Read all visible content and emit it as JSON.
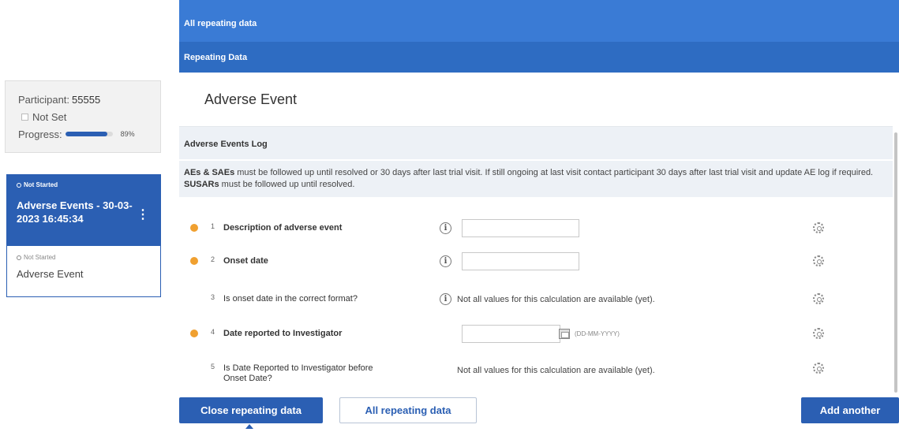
{
  "sidebar": {
    "participant_label": "Participant:",
    "participant_id": "55555",
    "status_label": "Not Set",
    "progress_label": "Progress:",
    "progress_value": 0.89,
    "progress_text": "89%",
    "event_card": {
      "status": "Not Started",
      "title": "Adverse Events - 30-03-2023 16:45:34",
      "menu_icon": "kebab-menu-icon",
      "sub_status": "Not Started",
      "sub_label": "Adverse Event"
    }
  },
  "main": {
    "all_repeating_label": "All repeating data",
    "repeating_label": "Repeating Data",
    "form_title": "Adverse Event",
    "section_title": "Adverse Events Log",
    "info": {
      "part1_bold": "AEs & SAEs",
      "part2": " must be followed up until resolved or 30 days after last trial visit. If still ongoing at last visit contact participant 30 days after last trial visit and update AE log if required. ",
      "part3_bold": "SUSARs",
      "part4": " must be followed up until resolved."
    },
    "questions": [
      {
        "num": "1",
        "label": "Description of adverse event",
        "value": ""
      },
      {
        "num": "2",
        "label": "Onset date",
        "value": ""
      },
      {
        "num": "3",
        "label": "Is onset date in the correct format?",
        "calc": "Not all values for this calculation are available (yet)."
      },
      {
        "num": "4",
        "label": "Date reported to Investigator",
        "value": "",
        "format_hint": "(DD-MM-YYYY)"
      },
      {
        "num": "5",
        "label": "Is Date Reported to Investigator before Onset Date?",
        "calc": "Not all values for this calculation are available (yet)."
      }
    ],
    "info_icon_glyph": "i"
  },
  "footer": {
    "close_label": "Close repeating data",
    "all_label": "All repeating data",
    "add_label": "Add another"
  },
  "colors": {
    "primary": "#2b5fb3",
    "header_bar": "#3a7bd5",
    "required_dot": "#f0a030",
    "section_bg": "#edf1f6"
  }
}
